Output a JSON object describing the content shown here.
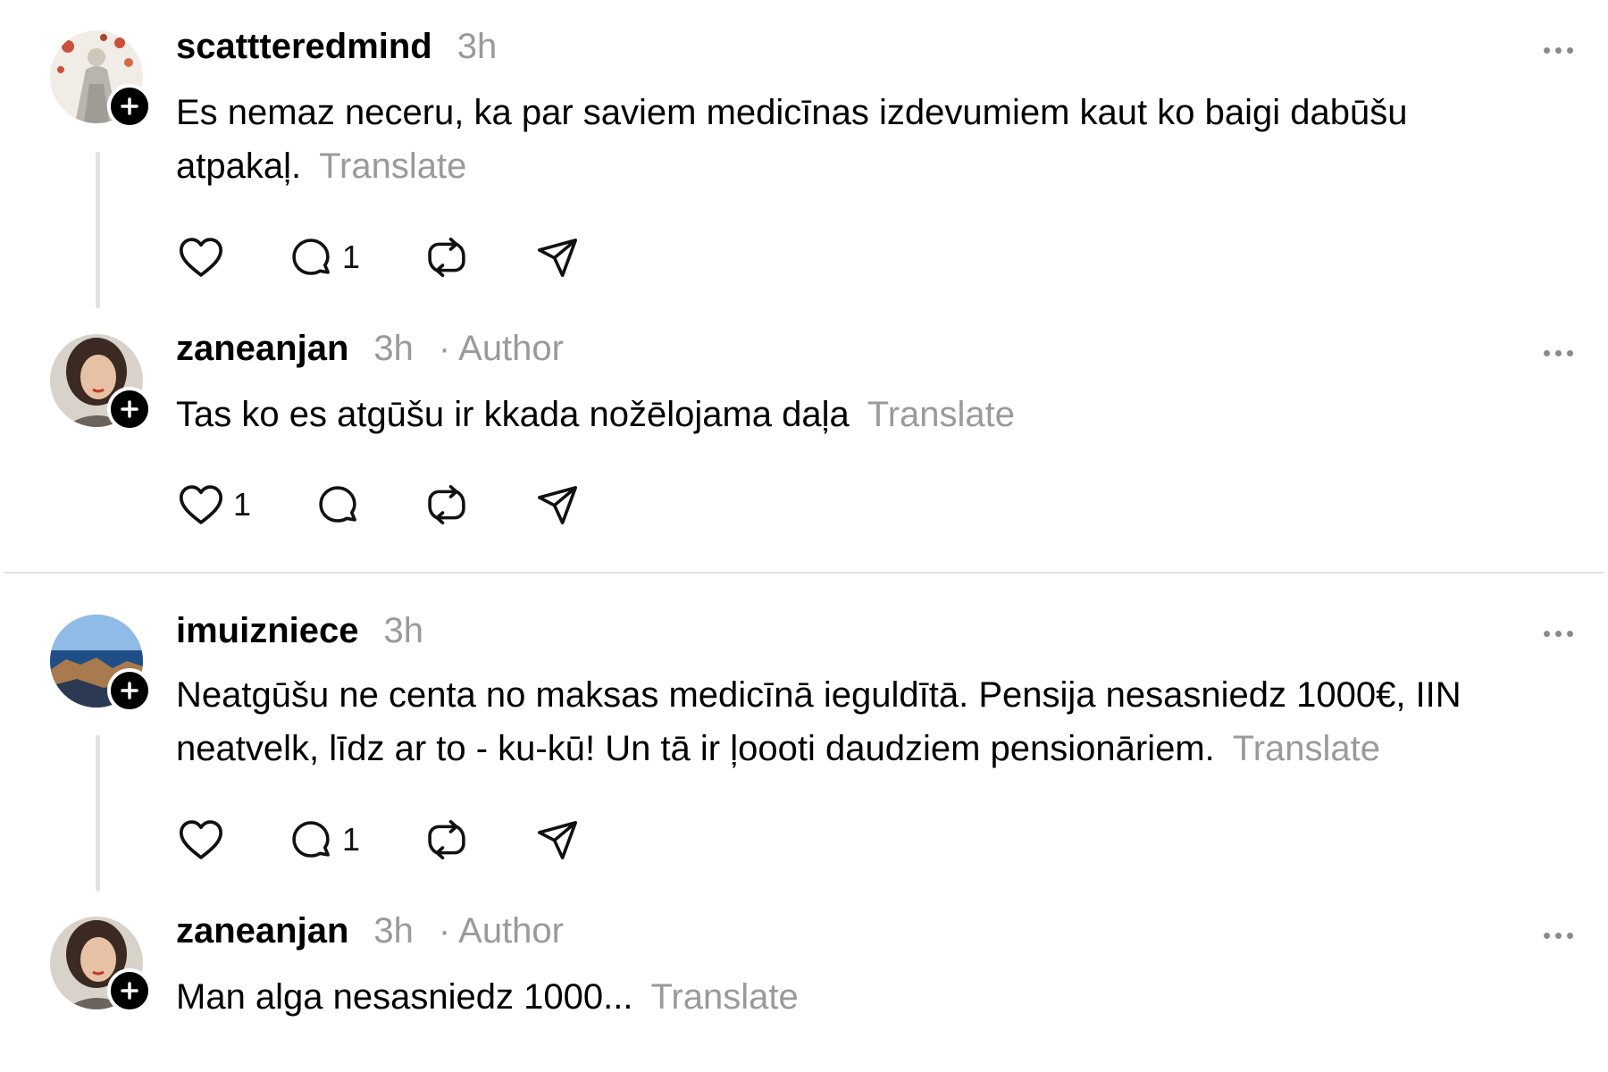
{
  "posts": [
    {
      "username": "scattteredmind",
      "time": "3h",
      "author_label": "",
      "text": "Es nemaz neceru, ka par saviem medicīnas izdevumiem kaut ko baigi dabūšu atpakaļ.",
      "translate": "Translate",
      "like_count": "",
      "reply_count": "1"
    },
    {
      "username": "zaneanjan",
      "time": "3h",
      "author_label": "· Author",
      "text": "Tas ko es atgūšu ir kkada nožēlojama daļa",
      "translate": "Translate",
      "like_count": "1",
      "reply_count": ""
    },
    {
      "username": "imuizniece",
      "time": "3h",
      "author_label": "",
      "text": "Neatgūšu ne centa no maksas medicīnā ieguldītā. Pensija nesasniedz 1000€, IIN neatvelk, līdz ar to - ku-kū! Un tā ir ļoooti daudziem pensionāriem.",
      "translate": "Translate",
      "like_count": "",
      "reply_count": "1"
    },
    {
      "username": "zaneanjan",
      "time": "3h",
      "author_label": "· Author",
      "text": "Man alga nesasniedz 1000...",
      "translate": "Translate",
      "like_count": "",
      "reply_count": ""
    }
  ],
  "icons": {
    "like": "heart-icon",
    "reply": "comment-icon",
    "repost": "repost-icon",
    "share": "share-icon",
    "more": "more-icon",
    "follow": "plus-icon"
  },
  "colors": {
    "muted_text": "#9a9a9a",
    "thread_line": "#e2e2e2",
    "divider": "#e3e3e3"
  }
}
